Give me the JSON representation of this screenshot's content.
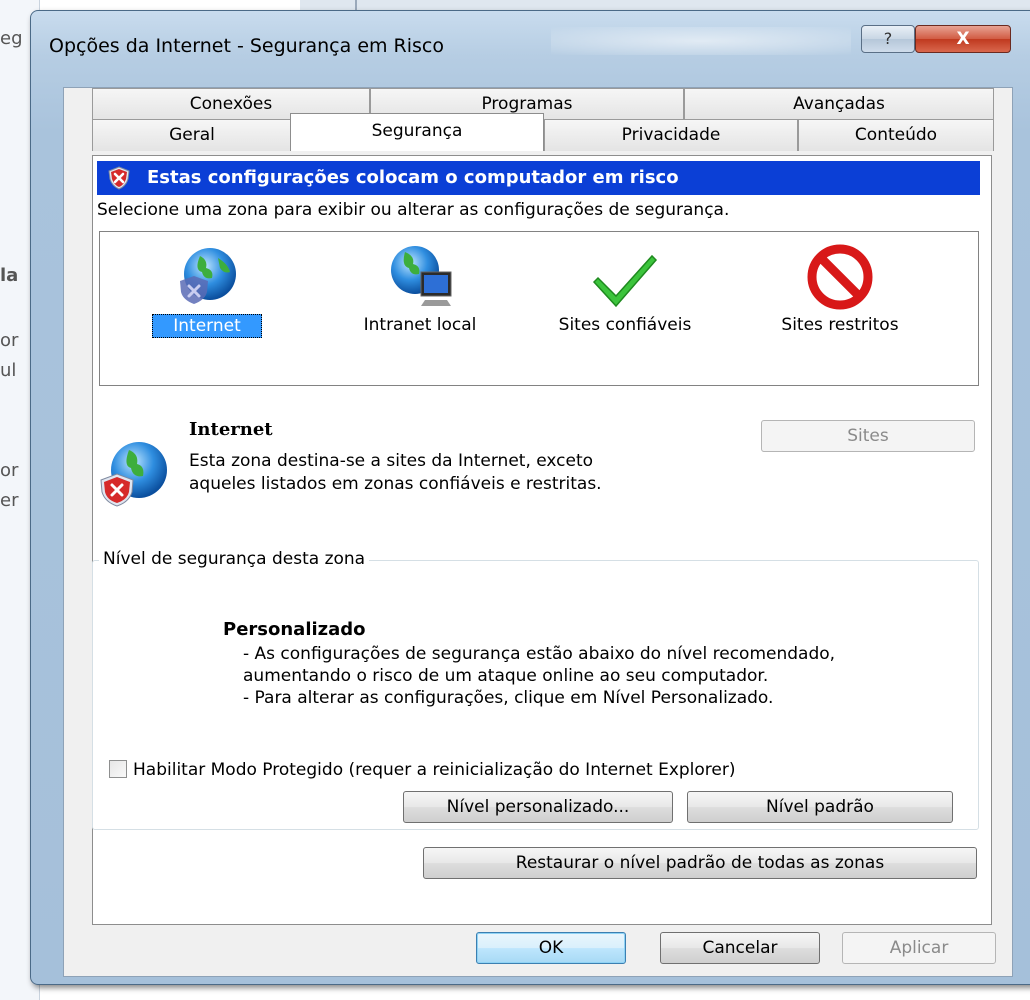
{
  "window": {
    "title": "Opções da Internet - Segurança em Risco",
    "help_glyph": "?",
    "close_glyph": "X"
  },
  "background_fragments": [
    "eg",
    "la",
    "or",
    "ul",
    "or",
    "er"
  ],
  "tabs_back": [
    {
      "label": "Conexões"
    },
    {
      "label": "Programas"
    },
    {
      "label": "Avançadas"
    }
  ],
  "tabs_front": [
    {
      "label": "Geral"
    },
    {
      "label": "Segurança",
      "active": true
    },
    {
      "label": "Privacidade"
    },
    {
      "label": "Conteúdo"
    }
  ],
  "warning": {
    "text": "Estas configurações colocam o computador em risco",
    "icon": "shield-x-icon",
    "color": "#0b3fd6"
  },
  "select_zone_text": "Selecione uma zona para exibir ou alterar as configurações de segurança.",
  "zones": [
    {
      "label": "Internet",
      "icon": "globe-shield-icon",
      "selected": true
    },
    {
      "label": "Intranet local",
      "icon": "globe-computer-icon",
      "selected": false
    },
    {
      "label": "Sites confiáveis",
      "icon": "checkmark-icon",
      "selected": false
    },
    {
      "label": "Sites restritos",
      "icon": "no-entry-icon",
      "selected": false
    }
  ],
  "zone_info": {
    "title": "Internet",
    "description": "Esta zona destina-se a sites da Internet, exceto aqueles listados em zonas confiáveis e restritas.",
    "sites_button": "Sites"
  },
  "security_level": {
    "group_label": "Nível de segurança desta zona",
    "level_name": "Personalizado",
    "desc_line1": "- As configurações de segurança estão abaixo do nível recomendado, aumentando o risco de um ataque online ao seu computador.",
    "desc_line2": "- Para alterar as configurações, clique em Nível Personalizado.",
    "protected_mode_label": "Habilitar Modo Protegido (requer a reinicialização do Internet Explorer)",
    "protected_mode_checked": false,
    "custom_level_button": "Nível personalizado...",
    "default_level_button": "Nível padrão"
  },
  "restore_all_button": "Restaurar o nível padrão de todas as zonas",
  "footer": {
    "ok": "OK",
    "cancel": "Cancelar",
    "apply": "Aplicar"
  }
}
